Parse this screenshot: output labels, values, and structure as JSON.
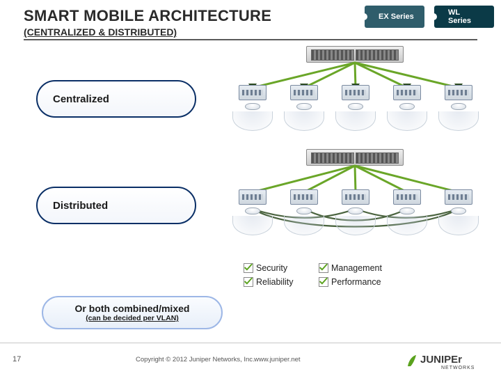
{
  "header": {
    "title": "SMART MOBILE ARCHITECTURE",
    "subtitle": "(CENTRALIZED & DISTRIBUTED)"
  },
  "tags": {
    "ex": "EX Series",
    "wl": "WL Series"
  },
  "sections": {
    "centralized": "Centralized",
    "distributed": "Distributed",
    "combined_line1": "Or both combined/mixed",
    "combined_line2": "(can be decided per VLAN)"
  },
  "features": {
    "security": "Security",
    "reliability": "Reliability",
    "management": "Management",
    "performance": "Performance"
  },
  "footer": {
    "page": "17",
    "copyright": "Copyright © 2012 Juniper Networks, Inc.",
    "url": "www.juniper.net",
    "brand": "JUNIPEr",
    "brand_sub": "NETWORKS"
  },
  "colors": {
    "link_green": "#6aa628",
    "link_dark": "#2c4a1f"
  }
}
